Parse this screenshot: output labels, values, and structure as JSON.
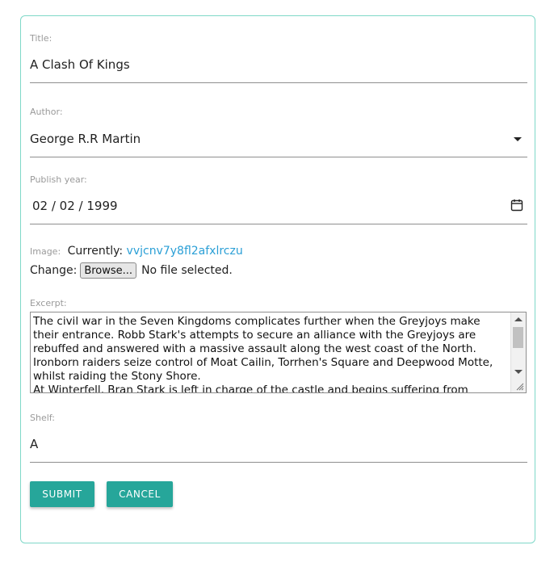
{
  "form": {
    "title": {
      "label": "Title:",
      "value": "A Clash Of Kings"
    },
    "author": {
      "label": "Author:",
      "value": "George R.R Martin"
    },
    "publish_year": {
      "label": "Publish year:",
      "value": "02 / 02 / 1999"
    },
    "image": {
      "label": "Image:",
      "currently_text": "Currently:",
      "current_file": "vvjcnv7y8fl2afxlrczu",
      "change_text": "Change:",
      "browse_label": "Browse...",
      "no_file_text": "No file selected."
    },
    "excerpt": {
      "label": "Excerpt:",
      "value": "The civil war in the Seven Kingdoms complicates further when the Greyjoys make their entrance. Robb Stark's attempts to secure an alliance with the Greyjoys are rebuffed and answered with a massive assault along the west coast of the North. Ironborn raiders seize control of Moat Cailin, Torrhen's Square and Deepwood Motte, whilst raiding the Stony Shore.\nAt Winterfell, Bran Stark is left in charge of the castle and begins suffering from strange"
    },
    "shelf": {
      "label": "Shelf:",
      "value": "A"
    }
  },
  "actions": {
    "submit_label": "SUBMIT",
    "cancel_label": "CANCEL"
  },
  "colors": {
    "accent": "#26a69a",
    "card_border": "#7fd8c8",
    "link": "#2a9fd6"
  },
  "icons": {
    "author_dropdown": "caret-down-icon",
    "date_picker": "calendar-icon"
  }
}
